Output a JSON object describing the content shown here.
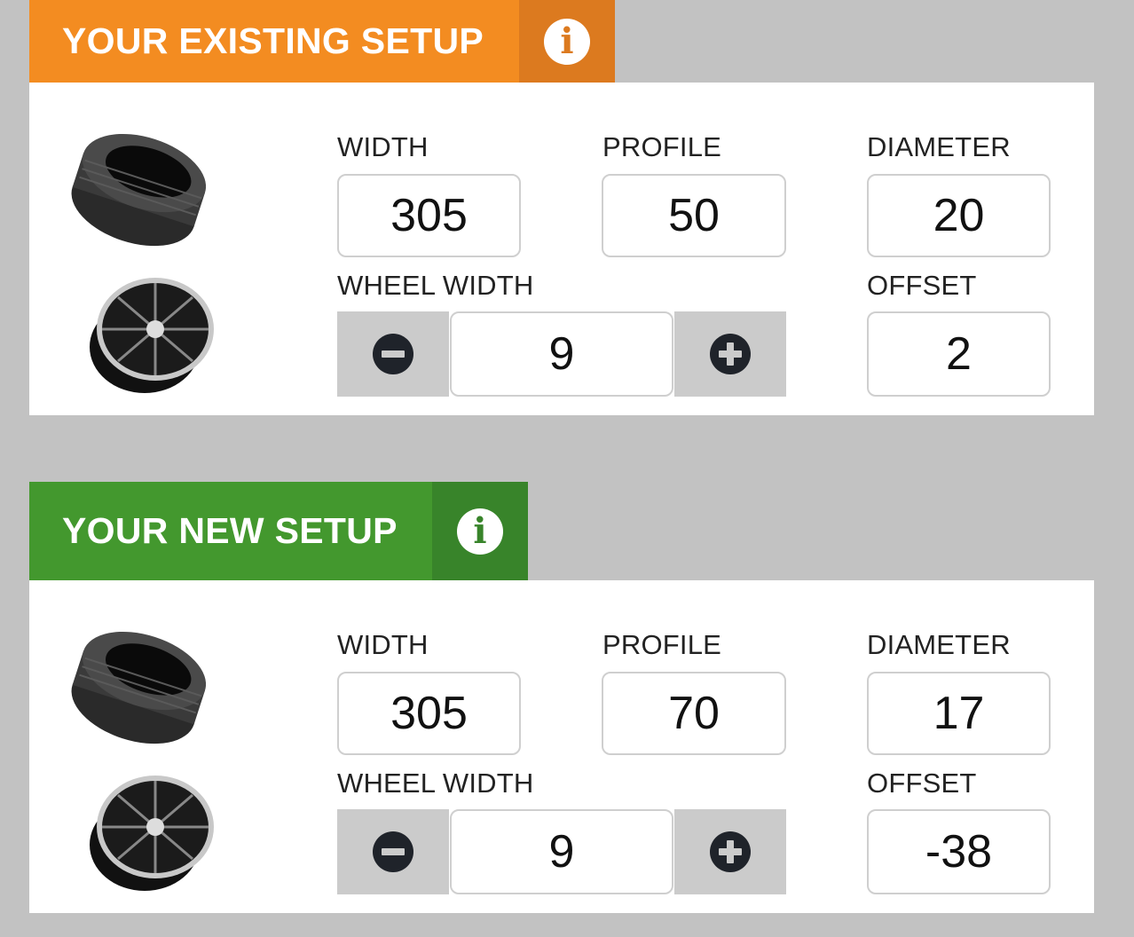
{
  "existing": {
    "title": "YOUR EXISTING SETUP",
    "info_icon": "info-icon",
    "labels": {
      "width": "WIDTH",
      "profile": "PROFILE",
      "diameter": "DIAMETER",
      "wheel_width": "WHEEL WIDTH",
      "offset": "OFFSET"
    },
    "values": {
      "width": "305",
      "profile": "50",
      "diameter": "20",
      "wheel_width": "9",
      "offset": "2"
    },
    "color": "#f38c21"
  },
  "new": {
    "title": "YOUR NEW SETUP",
    "info_icon": "info-icon",
    "labels": {
      "width": "WIDTH",
      "profile": "PROFILE",
      "diameter": "DIAMETER",
      "wheel_width": "WHEEL WIDTH",
      "offset": "OFFSET"
    },
    "values": {
      "width": "305",
      "profile": "70",
      "diameter": "17",
      "wheel_width": "9",
      "offset": "-38"
    },
    "color": "#43982e"
  },
  "icons": {
    "tire": "tire-icon",
    "wheel": "wheel-icon",
    "decrement": "minus-circle-icon",
    "increment": "plus-circle-icon"
  }
}
